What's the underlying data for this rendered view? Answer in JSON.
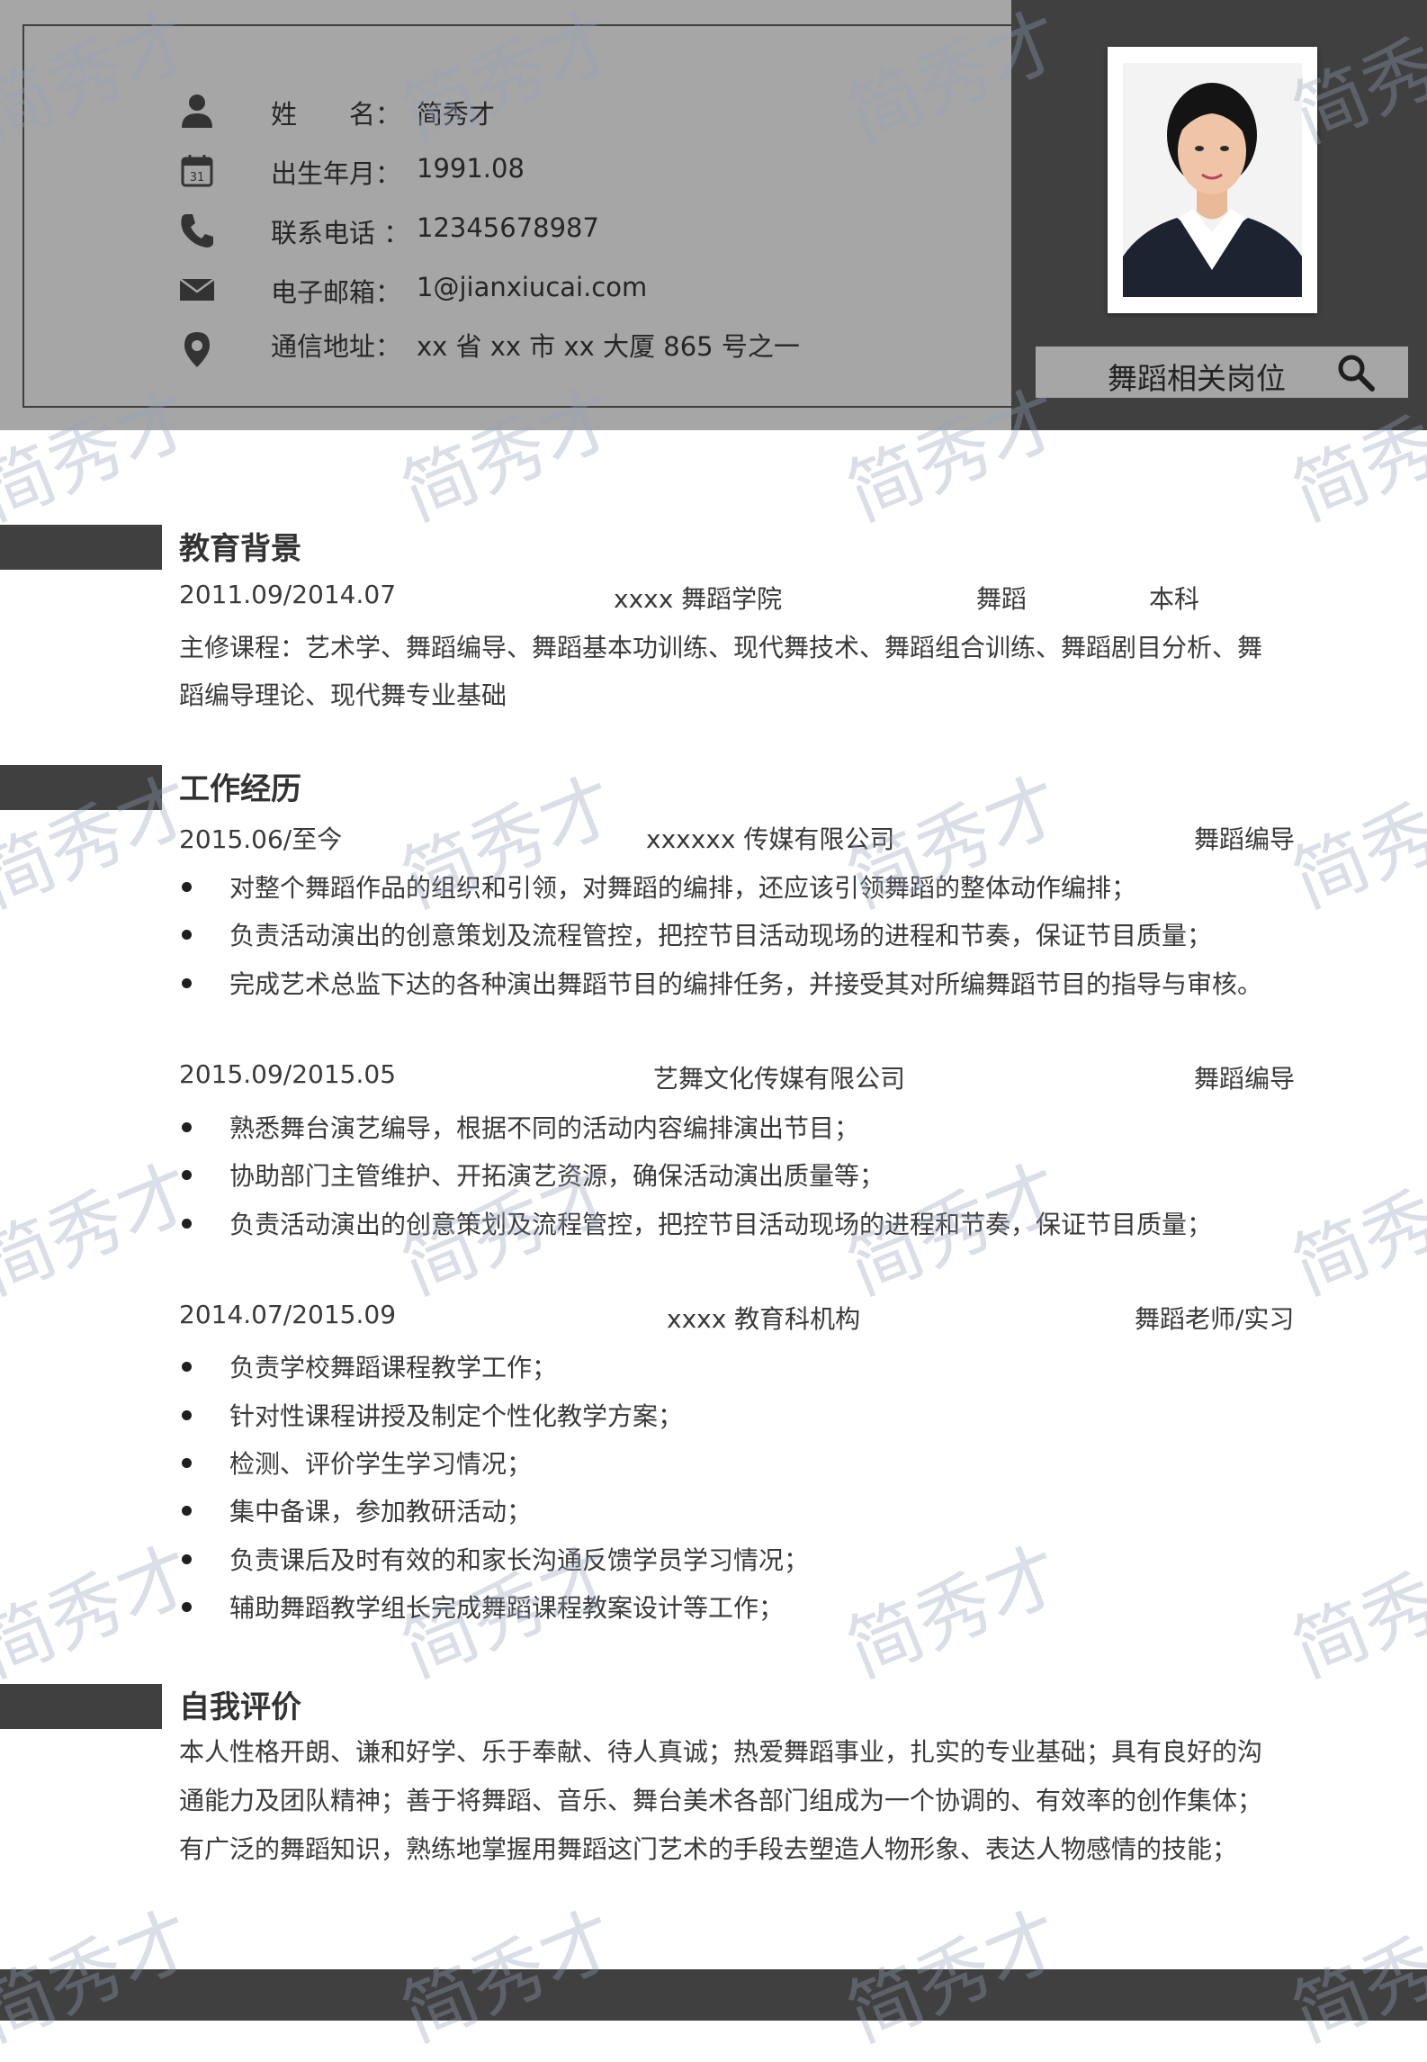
{
  "header": {
    "job_target": "舞蹈相关岗位",
    "info": [
      {
        "icon": "person-icon",
        "label": "姓　　名：",
        "value": "简秀才"
      },
      {
        "icon": "calendar-icon",
        "label": "出生年月：",
        "value": "1991.08"
      },
      {
        "icon": "phone-icon",
        "label": "联系电话 ：",
        "value": " 12345678987"
      },
      {
        "icon": "mail-icon",
        "label": "电子邮箱：",
        "value": "1@jianxiucai.com"
      },
      {
        "icon": "location-icon",
        "label": "通信地址：",
        "value": "xx 省 xx 市 xx 大厦 865 号之一"
      }
    ]
  },
  "education": {
    "title": "教育背景",
    "period": "2011.09/2014.07",
    "school": "xxxx 舞蹈学院",
    "major": "舞蹈",
    "degree": "本科",
    "courses_line1": "主修课程：艺术学、舞蹈编导、舞蹈基本功训练、现代舞技术、舞蹈组合训练、舞蹈剧目分析、舞",
    "courses_line2": "蹈编导理论、现代舞专业基础"
  },
  "work": {
    "title": "工作经历",
    "jobs": [
      {
        "period": "2015.06/至今",
        "company": "xxxxxx 传媒有限公司",
        "position": "舞蹈编导",
        "duties": [
          "对整个舞蹈作品的组织和引领，对舞蹈的编排，还应该引领舞蹈的整体动作编排；",
          "负责活动演出的创意策划及流程管控，把控节目活动现场的进程和节奏，保证节目质量；",
          "完成艺术总监下达的各种演出舞蹈节目的编排任务，并接受其对所编舞蹈节目的指导与审核。"
        ]
      },
      {
        "period": "2015.09/2015.05",
        "company": "艺舞文化传媒有限公司",
        "position": "舞蹈编导",
        "duties": [
          "熟悉舞台演艺编导，根据不同的活动内容编排演出节目；",
          "协助部门主管维护、开拓演艺资源，确保活动演出质量等；",
          "负责活动演出的创意策划及流程管控，把控节目活动现场的进程和节奏，保证节目质量；"
        ]
      },
      {
        "period": "2014.07/2015.09",
        "company": "xxxx 教育科机构",
        "position": "舞蹈老师/实习",
        "duties": [
          "负责学校舞蹈课程教学工作；",
          "针对性课程讲授及制定个性化教学方案；",
          "检测、评价学生学习情况；",
          "集中备课，参加教研活动；",
          "负责课后及时有效的和家长沟通反馈学员学习情况；",
          "辅助舞蹈教学组长完成舞蹈课程教案设计等工作；"
        ]
      }
    ]
  },
  "self_eval": {
    "title": "自我评价",
    "lines": [
      "本人性格开朗、谦和好学、乐于奉献、待人真诚；热爱舞蹈事业，扎实的专业基础；具有良好的沟",
      "通能力及团队精神；善于将舞蹈、音乐、舞台美术各部门组成为一个协调的、有效率的创作集体；",
      "有广泛的舞蹈知识，熟练地掌握用舞蹈这门艺术的手段去塑造人物形象、表达人物感情的技能；"
    ]
  },
  "watermark": "简秀才"
}
